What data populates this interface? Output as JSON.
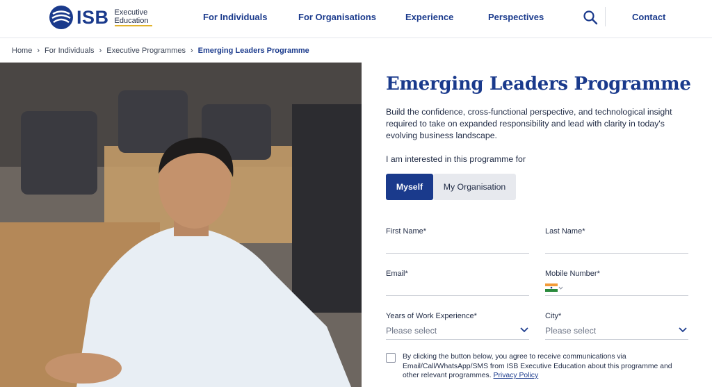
{
  "brand": {
    "name": "ISB",
    "sub_line1": "Executive",
    "sub_line2": "Education"
  },
  "nav": {
    "individuals": "For Individuals",
    "organisations": "For Organisations",
    "experience": "Experience",
    "perspectives": "Perspectives",
    "contact": "Contact"
  },
  "breadcrumb": {
    "home": "Home",
    "individuals": "For Individuals",
    "programmes": "Executive Programmes",
    "current": "Emerging Leaders Programme"
  },
  "hero": {
    "title": "Emerging Leaders Programme",
    "description": "Build the confidence, cross-functional perspective, and technological insight required to take on expanded responsibility and lead with clarity in today's evolving business landscape."
  },
  "form": {
    "interest_label": "I am interested in this programme for",
    "toggle_myself": "Myself",
    "toggle_org": "My Organisation",
    "first_name_label": "First Name*",
    "last_name_label": "Last Name*",
    "email_label": "Email*",
    "mobile_label": "Mobile Number*",
    "experience_label": "Years of Work Experience*",
    "experience_placeholder": "Please select",
    "city_label": "City*",
    "city_placeholder": "Please select",
    "consent_text": "By clicking the button below, you agree to receive communications via Email/Call/WhatsApp/SMS from ISB Executive Education about this programme and other relevant programmes.",
    "privacy_link": "Privacy Policy"
  },
  "colors": {
    "brand_blue": "#1a3a8c",
    "accent_gold": "#e2b32c"
  }
}
